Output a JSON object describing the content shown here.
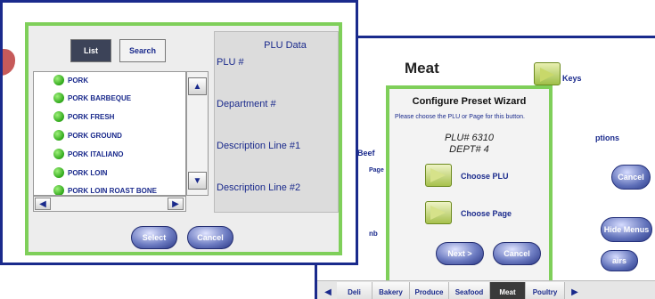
{
  "meat_screen": {
    "title": "Meat",
    "keys_label": "Keys",
    "side_labels": {
      "beef": "Beef",
      "page": "Page",
      "options": "ptions",
      "cancel": "Cancel",
      "hide_menus": "Hide Menus",
      "nb": "nb",
      "airs": "airs"
    },
    "wizard": {
      "title": "Configure Preset Wizard",
      "instruction": "Please choose the PLU or Page for this button.",
      "plu_line": "PLU# 6310",
      "dept_line": "DEPT# 4",
      "choose_plu": "Choose PLU",
      "choose_page": "Choose Page",
      "next": "Next >",
      "cancel": "Cancel"
    },
    "tabs": [
      {
        "label": "Deli",
        "active": false
      },
      {
        "label": "Bakery",
        "active": false
      },
      {
        "label": "Produce",
        "active": false
      },
      {
        "label": "Seafood",
        "active": false
      },
      {
        "label": "Meat",
        "active": true
      },
      {
        "label": "Poultry",
        "active": false
      }
    ]
  },
  "plu_screen": {
    "list_tab": "List",
    "search_tab": "Search",
    "items": [
      "PORK",
      "PORK BARBEQUE",
      "PORK FRESH",
      "PORK GROUND",
      "PORK ITALIANO",
      "PORK LOIN",
      "PORK LOIN ROAST BONE"
    ],
    "plu_data": {
      "title": "PLU Data",
      "plu_label": "PLU #",
      "department_label": "Department #",
      "desc1_label": "Description Line #1",
      "desc2_label": "Description Line #2"
    },
    "select": "Select",
    "cancel": "Cancel"
  },
  "colors": {
    "frame_blue": "#1a2a8c",
    "dialog_green": "#7fcf5a",
    "text_blue": "#1a2a8c"
  }
}
